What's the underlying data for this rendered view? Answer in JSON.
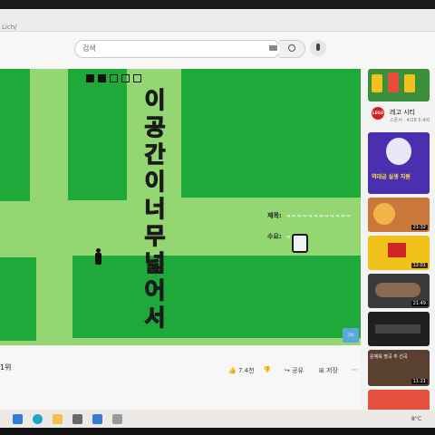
{
  "browser": {
    "url_fragment": "Lich/"
  },
  "header": {
    "search_placeholder": "검색"
  },
  "video": {
    "title_chars": [
      "이",
      "공",
      "간",
      "이",
      "너",
      "무",
      "넓",
      "어",
      "서"
    ],
    "info_label_1": "제목:",
    "info_value_1": "ㅋㅋㅋㅋㅋㅋㅋㅋㅋㅋㅋㅋ",
    "info_label_2": "수요:",
    "info_value_2": "ㅋㅋㅋㅋ",
    "corner_badge": "구독",
    "rank_label": "1위",
    "like_count": "7.4천",
    "share_label": "공유",
    "save_label": "저장"
  },
  "sidebar": {
    "channel_name": "레고 시티",
    "channel_sub": "스폰서 · 4/28 5:4/0",
    "thumbs": [
      {
        "duration": ""
      },
      {
        "duration": ""
      },
      {
        "duration": "21:32"
      },
      {
        "duration": "12:01"
      },
      {
        "duration": "21:49"
      },
      {
        "duration": ""
      },
      {
        "duration": "11:21"
      },
      {
        "duration": ""
      }
    ],
    "thumb_text_1": "역대급 실생 지원",
    "thumb_text_2": "운체육 명곡 추 선곡"
  },
  "taskbar": {
    "tray_text": "8°C"
  }
}
